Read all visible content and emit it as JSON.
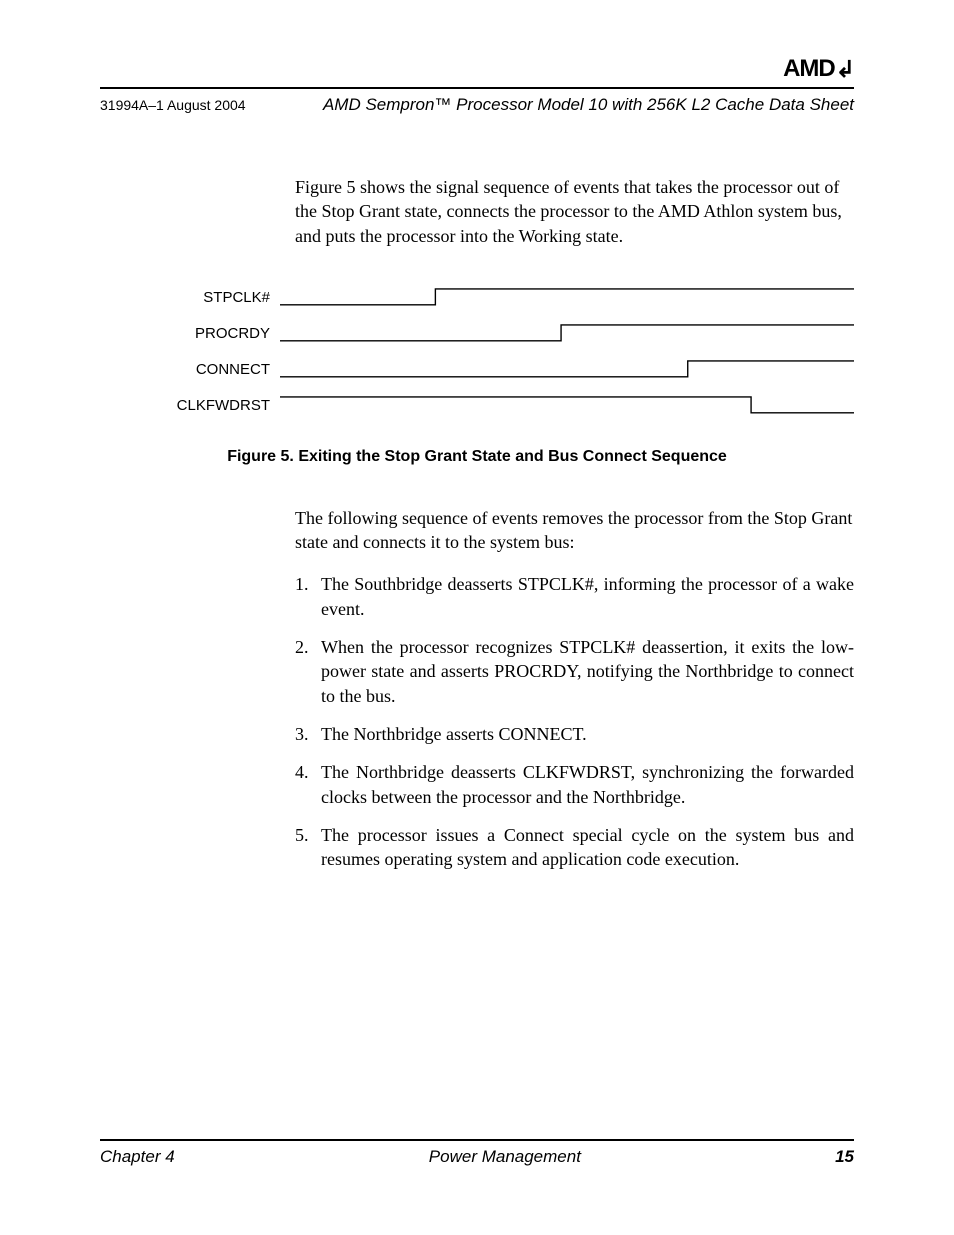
{
  "header": {
    "logo_text": "AMD",
    "doc_id": "31994A–1 August 2004",
    "doc_title": "AMD Sempron™ Processor Model 10 with 256K L2 Cache Data Sheet"
  },
  "intro": "Figure 5 shows the signal sequence of events that takes the processor out of the Stop Grant state, connects the processor to the AMD Athlon system bus, and puts the processor into the Working state.",
  "signals": {
    "s1": "STPCLK#",
    "s2": "PROCRDY",
    "s3": "CONNECT",
    "s4": "CLKFWDRST"
  },
  "figure_caption": "Figure 5.   Exiting the Stop Grant State and Bus Connect Sequence",
  "list_intro": "The following sequence of events removes the processor from the Stop Grant state and connects it to the system bus:",
  "steps": {
    "n1": "1.",
    "t1": "The Southbridge deasserts STPCLK#, informing the processor of a wake event.",
    "n2": "2.",
    "t2": "When the processor recognizes STPCLK# deassertion, it exits the low-power state and asserts PROCRDY, notifying the Northbridge to connect to the bus.",
    "n3": "3.",
    "t3": "The Northbridge asserts CONNECT.",
    "n4": "4.",
    "t4": "The Northbridge deasserts CLKFWDRST, synchronizing the forwarded clocks between the processor and the Northbridge.",
    "n5": "5.",
    "t5": "The processor issues a Connect special cycle on the system bus and resumes operating system and application code execution."
  },
  "footer": {
    "chapter": "Chapter 4",
    "section": "Power Management",
    "page": "15"
  },
  "chart_data": {
    "type": "timing-diagram",
    "signals": [
      {
        "name": "STPCLK#",
        "edges": [
          {
            "t": 0.27,
            "dir": "rise"
          }
        ]
      },
      {
        "name": "PROCRDY",
        "edges": [
          {
            "t": 0.49,
            "dir": "rise"
          }
        ]
      },
      {
        "name": "CONNECT",
        "edges": [
          {
            "t": 0.71,
            "dir": "rise"
          }
        ]
      },
      {
        "name": "CLKFWDRST",
        "edges": [
          {
            "t": 0.82,
            "dir": "fall"
          }
        ]
      }
    ],
    "title": "Exiting the Stop Grant State and Bus Connect Sequence"
  }
}
